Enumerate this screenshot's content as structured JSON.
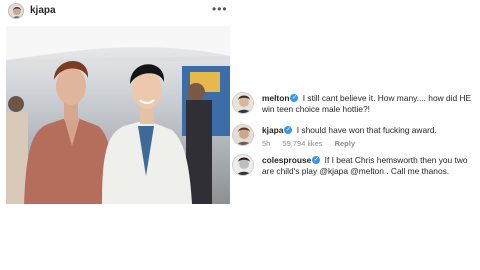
{
  "header": {
    "username": "kjapa",
    "more_label": "•••"
  },
  "photo": {
    "alt_description": ""
  },
  "comments": [
    {
      "username": "melton",
      "verified": true,
      "text": "I still cant believe it. How many.... how did HE win teen choice male hottie?!"
    },
    {
      "username": "kjapa",
      "verified": true,
      "text": "I should have won that fucking award.",
      "time": "5h",
      "likes": "59,794 likes",
      "reply": "Reply"
    },
    {
      "username": "colesprouse",
      "verified": true,
      "text": "If I beat Chris hemsworth then you two are child's play @kjapa @melton . Call me thanos."
    }
  ],
  "colors": {
    "verified": "#3897f0",
    "meta": "#8e8e8e"
  }
}
